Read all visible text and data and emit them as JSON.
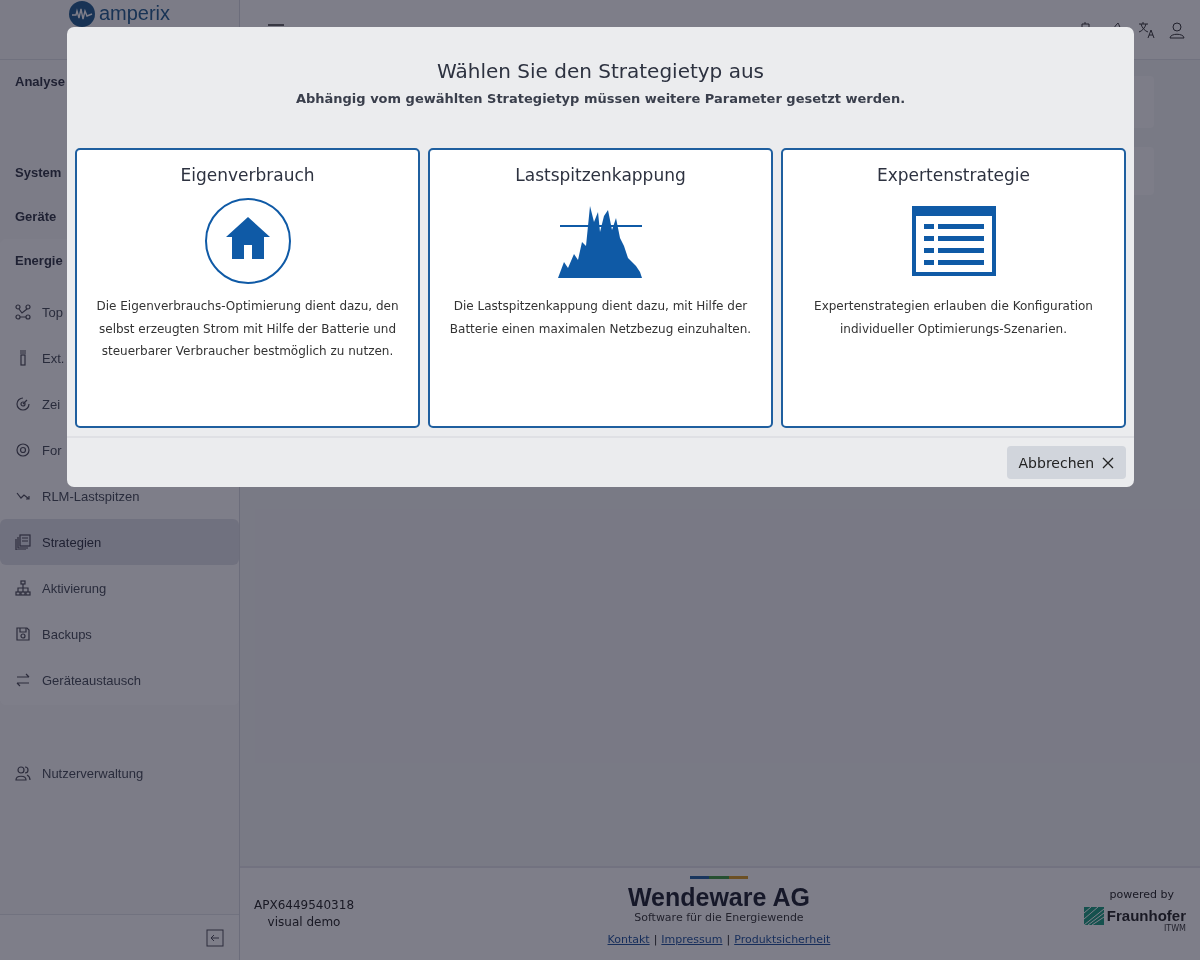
{
  "sidebar": {
    "logo": "amperix",
    "headings": [
      "Analyse",
      "System",
      "Geräte"
    ],
    "group": {
      "title": "Energie",
      "items": [
        {
          "label": "Top",
          "selected": false
        },
        {
          "label": "Ext.",
          "selected": false
        },
        {
          "label": "Zei",
          "selected": false
        },
        {
          "label": "For",
          "selected": false
        },
        {
          "label": "RLM-Lastspitzen",
          "selected": false
        },
        {
          "label": "Strategien",
          "selected": true
        },
        {
          "label": "Aktivierung",
          "selected": false
        },
        {
          "label": "Backups",
          "selected": false
        },
        {
          "label": "Geräteaustausch",
          "selected": false
        }
      ]
    },
    "extra_items": [
      {
        "label": "Nutzerverwaltung",
        "selected": false
      }
    ]
  },
  "footer": {
    "device_id": "APX6449540318",
    "mode": "visual demo",
    "company": "Wendeware AG",
    "tagline": "Software für die Energiewende",
    "links": [
      "Kontakt",
      "Impressum",
      "Produktsicherheit"
    ],
    "link_separator": "|",
    "powered_by": "powered by",
    "partner": "Fraunhofer",
    "partner_sub": "ITWM"
  },
  "dialog": {
    "title": "Wählen Sie den Strategietyp aus",
    "subtitle": "Abhängig vom gewählten Strategietyp müssen weitere Parameter gesetzt werden.",
    "options": [
      {
        "kind": "house",
        "title": "Eigenverbrauch",
        "text": "Die Eigenverbrauchs-Optimierung dient dazu, den selbst erzeugten Strom mit Hilfe der Batterie und steuerbarer Verbraucher bestmöglich zu nutzen."
      },
      {
        "kind": "peak",
        "title": "Lastspitzenkappung",
        "text": "Die Lastspitzenkappung dient dazu, mit Hilfe der Batterie einen maximalen Netzbezug einzuhalten."
      },
      {
        "kind": "list",
        "title": "Expertenstrategie",
        "text": "Expertenstrategien erlauben die Konfiguration individueller Optimierungs-Szenarien."
      }
    ],
    "cancel": "Abbrechen"
  }
}
